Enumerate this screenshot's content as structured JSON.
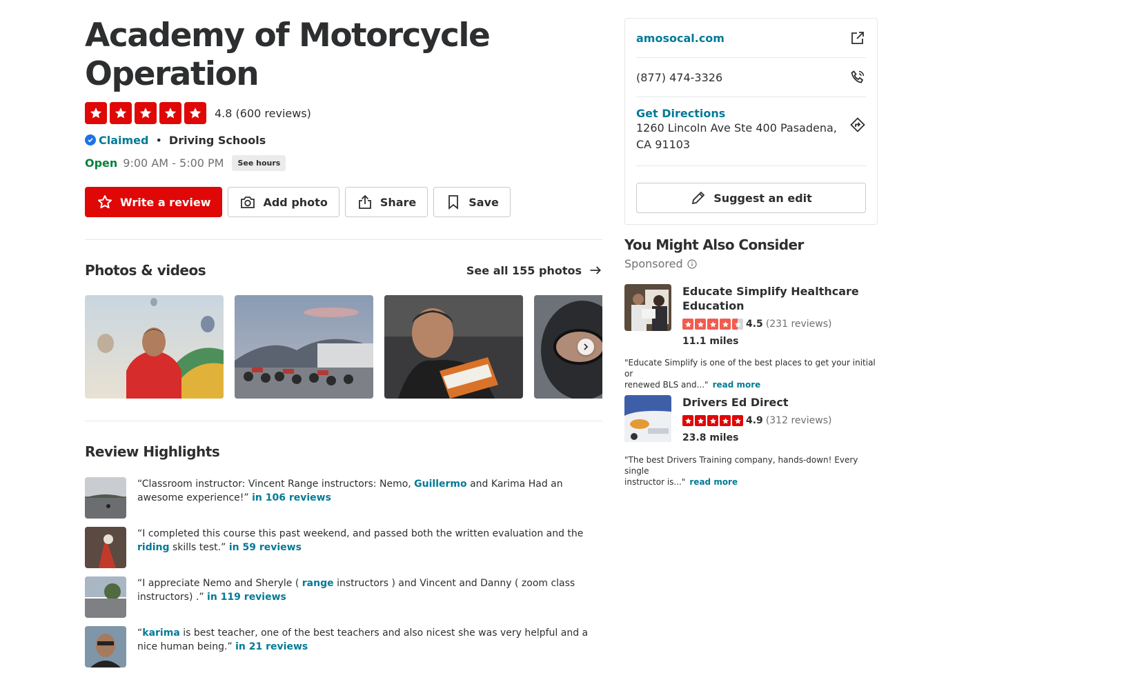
{
  "business": {
    "name_line1": "Academy of Motorcycle",
    "name_line2": "Operation",
    "rating_text": "4.8 (600 reviews)",
    "rating": 4.8,
    "claimed_label": "Claimed",
    "separator": "•",
    "category": "Driving Schools",
    "open_label": "Open",
    "hours": "9:00 AM - 5:00 PM",
    "see_hours_label": "See hours"
  },
  "actions": {
    "write_review": "Write a review",
    "add_photo": "Add photo",
    "share": "Share",
    "save": "Save"
  },
  "photos": {
    "title": "Photos & videos",
    "see_all": "See all 155 photos"
  },
  "highlights": {
    "title": "Review Highlights",
    "items": [
      {
        "pre": "“Classroom instructor: Vincent Range instructors: Nemo, ",
        "kw": "Guillermo",
        "post": " and Karima Had an awesome experience!” ",
        "link": "in 106 reviews"
      },
      {
        "pre": "“I completed this course this past weekend, and passed both the written evaluation and the ",
        "kw": "riding",
        "post": " skills test.” ",
        "link": "in 59 reviews"
      },
      {
        "pre": "“I appreciate Nemo and Sheryle ( ",
        "kw": "range",
        "post": " instructors ) and Vincent and Danny ( zoom class instructors) .” ",
        "link": "in 119 reviews"
      },
      {
        "pre": "“",
        "kw": "karima",
        "post": " is best teacher, one of the best teachers and also nicest she was very helpful and a nice human being.” ",
        "link": "in 21 reviews"
      }
    ]
  },
  "sidebar": {
    "website": "amosocal.com",
    "phone": "(877) 474-3326",
    "directions_label": "Get Directions",
    "address_line1": "1260 Lincoln Ave Ste 400 Pasadena,",
    "address_line2": "CA 91103",
    "suggest_edit": "Suggest an edit",
    "consider_title": "You Might Also Consider",
    "sponsored_label": "Sponsored",
    "ads": [
      {
        "name_line1": "Educate Simplify Healthcare",
        "name_line2": "Education",
        "score": "4.5",
        "count": "(231 reviews)",
        "rating": 4.5,
        "miles": "11.1 miles",
        "quote_line1": "\"Educate Simplify is one of the best places to get your initial or",
        "quote_line2": "renewed BLS and...\"",
        "read_more": "read more"
      },
      {
        "name_line1": "Drivers Ed Direct",
        "name_line2": "",
        "score": "4.9",
        "count": "(312 reviews)",
        "rating": 4.9,
        "miles": "23.8 miles",
        "quote_line1": "\"The best Drivers Training company, hands-down! Every single",
        "quote_line2": "instructor is...\"",
        "read_more": "read more"
      }
    ]
  },
  "colors": {
    "star_red": "#e00707",
    "star_orange": "#f15c4f",
    "link_teal": "#027a97",
    "open_green": "#04813c",
    "claimed_check_blue": "#1a73e8"
  }
}
